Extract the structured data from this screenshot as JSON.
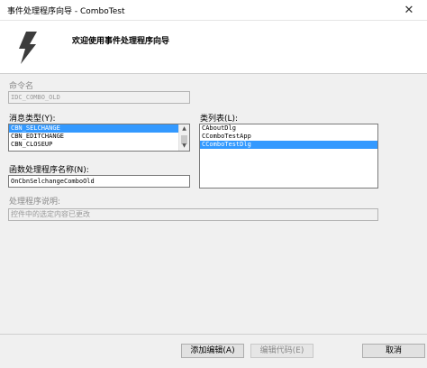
{
  "window": {
    "title": "事件处理程序向导 - ComboTest",
    "close_glyph": "✕"
  },
  "banner": {
    "icon": "lightning-icon",
    "heading": "欢迎使用事件处理程序向导"
  },
  "command_name": {
    "label": "命令名",
    "value": "IDC_COMBO_OLD"
  },
  "message_type": {
    "label": "消息类型(Y):",
    "items": [
      "CBN_SELCHANGE",
      "CBN_EDITCHANGE",
      "CBN_CLOSEUP"
    ],
    "selected": "CBN_SELCHANGE"
  },
  "class_list": {
    "label": "类列表(L):",
    "items": [
      "CAboutDlg",
      "CComboTestApp",
      "CComboTestDlg"
    ],
    "selected": "CComboTestDlg"
  },
  "function_name": {
    "label": "函数处理程序名称(N):",
    "value": "OnCbnSelchangeComboOld"
  },
  "handler_description": {
    "label": "处理程序说明:",
    "value": "控件中的选定内容已更改"
  },
  "buttons": {
    "add_edit": "添加编辑(A)",
    "edit_code": "编辑代码(E)",
    "cancel": "取消"
  },
  "colors": {
    "selection": "#3399ff",
    "window_bg": "#f0f0f0",
    "banner_bg": "#ffffff"
  }
}
